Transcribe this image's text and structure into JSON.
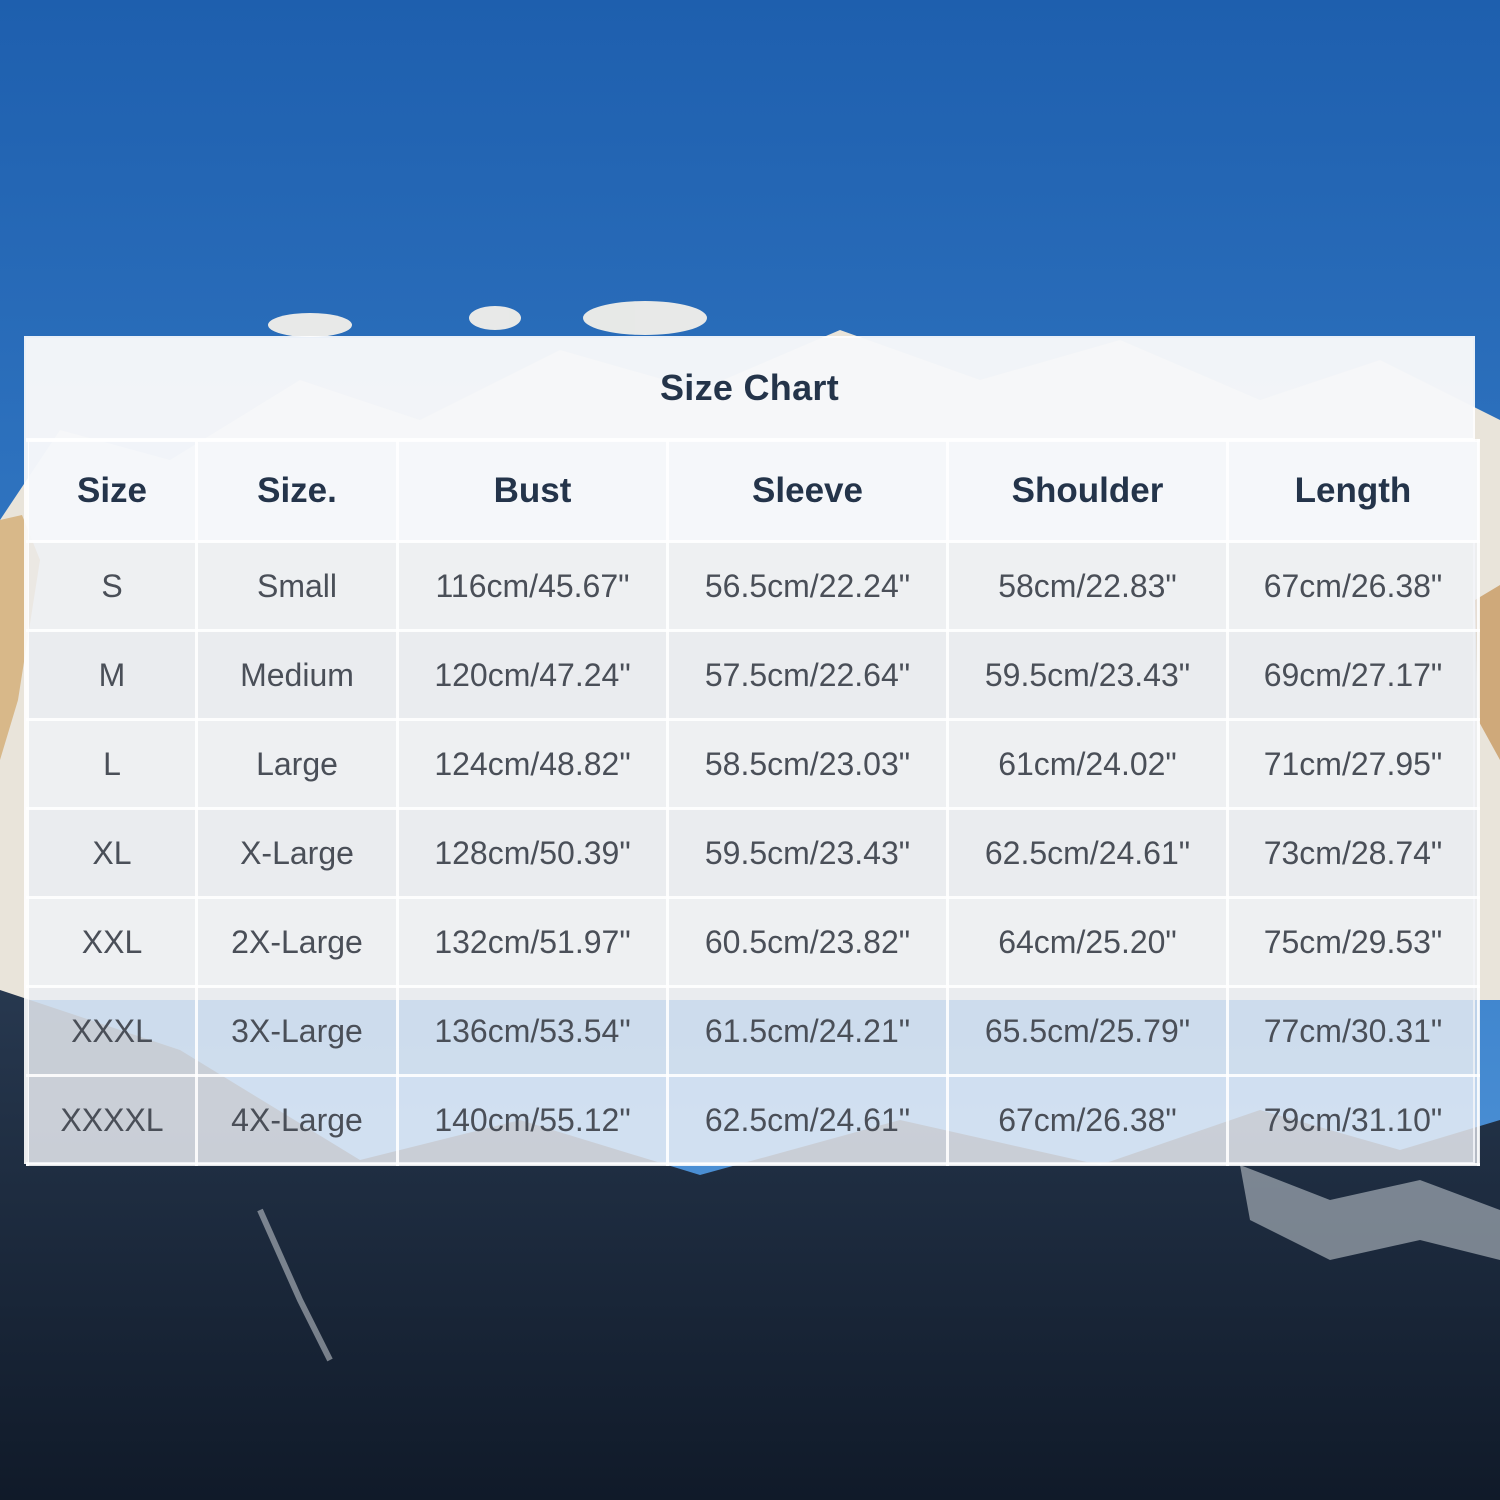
{
  "colors": {
    "sky_top": "#1e5fae",
    "sky_bottom": "#4f94d8",
    "header_text": "#24344a",
    "cell_text": "#4a4f58"
  },
  "background": {
    "scene": "mountain-landscape"
  },
  "chart": {
    "title": "Size Chart",
    "columns": [
      "Size",
      "Size.",
      "Bust",
      "Sleeve",
      "Shoulder",
      "Length"
    ],
    "rows": [
      [
        "S",
        "Small",
        "116cm/45.67\"",
        "56.5cm/22.24\"",
        "58cm/22.83\"",
        "67cm/26.38\""
      ],
      [
        "M",
        "Medium",
        "120cm/47.24\"",
        "57.5cm/22.64\"",
        "59.5cm/23.43\"",
        "69cm/27.17\""
      ],
      [
        "L",
        "Large",
        "124cm/48.82\"",
        "58.5cm/23.03\"",
        "61cm/24.02\"",
        "71cm/27.95\""
      ],
      [
        "XL",
        "X-Large",
        "128cm/50.39\"",
        "59.5cm/23.43\"",
        "62.5cm/24.61\"",
        "73cm/28.74\""
      ],
      [
        "XXL",
        "2X-Large",
        "132cm/51.97\"",
        "60.5cm/23.82\"",
        "64cm/25.20\"",
        "75cm/29.53\""
      ],
      [
        "XXXL",
        "3X-Large",
        "136cm/53.54\"",
        "61.5cm/24.21\"",
        "65.5cm/25.79\"",
        "77cm/30.31\""
      ],
      [
        "XXXXL",
        "4X-Large",
        "140cm/55.12\"",
        "62.5cm/24.61\"",
        "67cm/26.38\"",
        "79cm/31.10\""
      ]
    ]
  }
}
